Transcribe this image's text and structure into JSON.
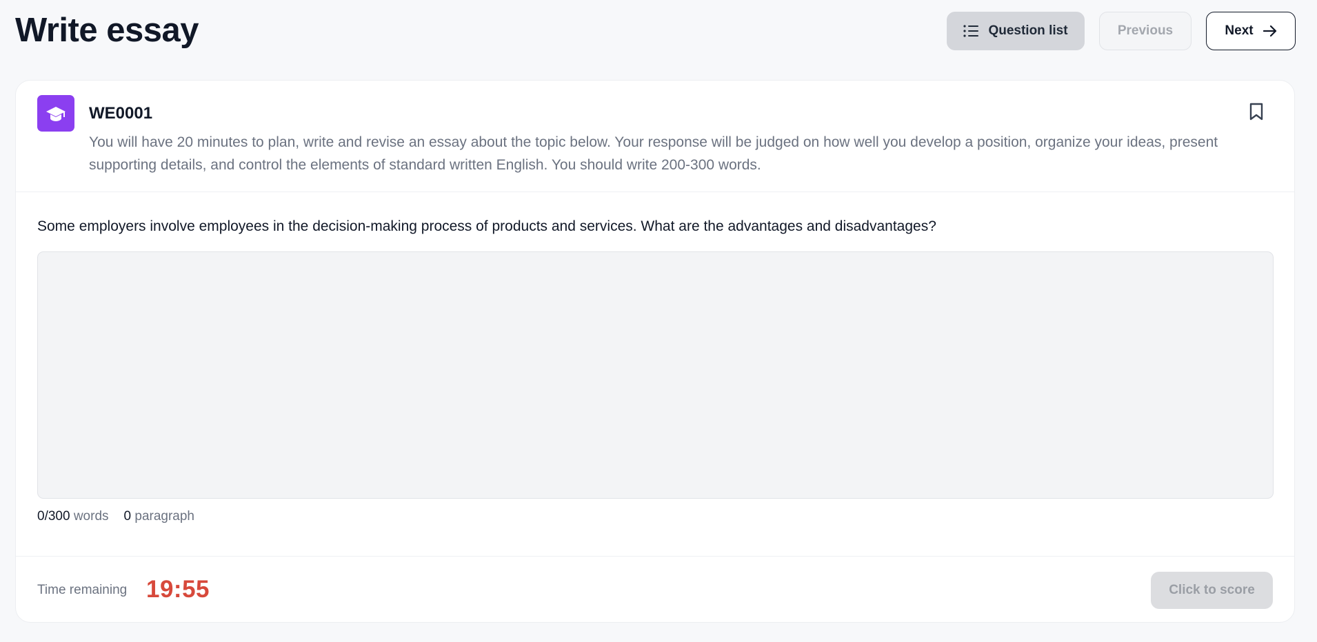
{
  "header": {
    "title": "Write essay",
    "question_list_label": "Question list",
    "previous_label": "Previous",
    "next_label": "Next"
  },
  "question": {
    "id": "WE0001",
    "instructions": "You will have 20 minutes to plan, write and revise an essay about the topic below. Your response will be judged on how well you develop a position, organize your ideas, present supporting details, and control the elements of standard written English. You should write 200-300 words.",
    "prompt": "Some employers involve employees in the decision-making process of products and services. What are the advantages and disadvantages?",
    "essay_value": ""
  },
  "counts": {
    "words_value": "0/300",
    "words_label": "words",
    "paragraph_value": "0",
    "paragraph_label": "paragraph"
  },
  "footer": {
    "time_label": "Time remaining",
    "time_value": "19:55",
    "score_label": "Click to score"
  },
  "colors": {
    "accent": "#8b3ff0",
    "timer": "#d7493b"
  },
  "icons": [
    "list-icon",
    "arrow-right-icon",
    "graduation-cap-icon",
    "bookmark-icon"
  ]
}
